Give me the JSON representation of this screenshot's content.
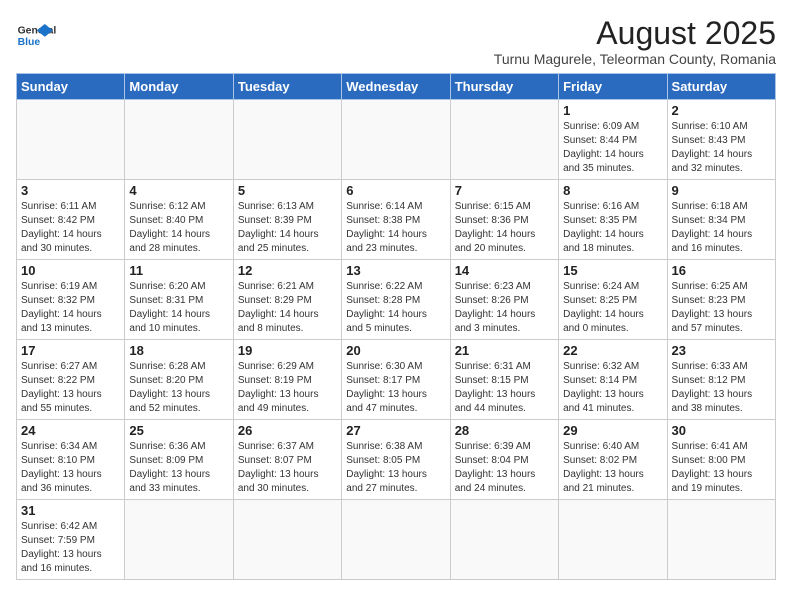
{
  "logo": {
    "text_general": "General",
    "text_blue": "Blue"
  },
  "title": "August 2025",
  "subtitle": "Turnu Magurele, Teleorman County, Romania",
  "weekdays": [
    "Sunday",
    "Monday",
    "Tuesday",
    "Wednesday",
    "Thursday",
    "Friday",
    "Saturday"
  ],
  "weeks": [
    [
      {
        "day": "",
        "info": ""
      },
      {
        "day": "",
        "info": ""
      },
      {
        "day": "",
        "info": ""
      },
      {
        "day": "",
        "info": ""
      },
      {
        "day": "",
        "info": ""
      },
      {
        "day": "1",
        "info": "Sunrise: 6:09 AM\nSunset: 8:44 PM\nDaylight: 14 hours and 35 minutes."
      },
      {
        "day": "2",
        "info": "Sunrise: 6:10 AM\nSunset: 8:43 PM\nDaylight: 14 hours and 32 minutes."
      }
    ],
    [
      {
        "day": "3",
        "info": "Sunrise: 6:11 AM\nSunset: 8:42 PM\nDaylight: 14 hours and 30 minutes."
      },
      {
        "day": "4",
        "info": "Sunrise: 6:12 AM\nSunset: 8:40 PM\nDaylight: 14 hours and 28 minutes."
      },
      {
        "day": "5",
        "info": "Sunrise: 6:13 AM\nSunset: 8:39 PM\nDaylight: 14 hours and 25 minutes."
      },
      {
        "day": "6",
        "info": "Sunrise: 6:14 AM\nSunset: 8:38 PM\nDaylight: 14 hours and 23 minutes."
      },
      {
        "day": "7",
        "info": "Sunrise: 6:15 AM\nSunset: 8:36 PM\nDaylight: 14 hours and 20 minutes."
      },
      {
        "day": "8",
        "info": "Sunrise: 6:16 AM\nSunset: 8:35 PM\nDaylight: 14 hours and 18 minutes."
      },
      {
        "day": "9",
        "info": "Sunrise: 6:18 AM\nSunset: 8:34 PM\nDaylight: 14 hours and 16 minutes."
      }
    ],
    [
      {
        "day": "10",
        "info": "Sunrise: 6:19 AM\nSunset: 8:32 PM\nDaylight: 14 hours and 13 minutes."
      },
      {
        "day": "11",
        "info": "Sunrise: 6:20 AM\nSunset: 8:31 PM\nDaylight: 14 hours and 10 minutes."
      },
      {
        "day": "12",
        "info": "Sunrise: 6:21 AM\nSunset: 8:29 PM\nDaylight: 14 hours and 8 minutes."
      },
      {
        "day": "13",
        "info": "Sunrise: 6:22 AM\nSunset: 8:28 PM\nDaylight: 14 hours and 5 minutes."
      },
      {
        "day": "14",
        "info": "Sunrise: 6:23 AM\nSunset: 8:26 PM\nDaylight: 14 hours and 3 minutes."
      },
      {
        "day": "15",
        "info": "Sunrise: 6:24 AM\nSunset: 8:25 PM\nDaylight: 14 hours and 0 minutes."
      },
      {
        "day": "16",
        "info": "Sunrise: 6:25 AM\nSunset: 8:23 PM\nDaylight: 13 hours and 57 minutes."
      }
    ],
    [
      {
        "day": "17",
        "info": "Sunrise: 6:27 AM\nSunset: 8:22 PM\nDaylight: 13 hours and 55 minutes."
      },
      {
        "day": "18",
        "info": "Sunrise: 6:28 AM\nSunset: 8:20 PM\nDaylight: 13 hours and 52 minutes."
      },
      {
        "day": "19",
        "info": "Sunrise: 6:29 AM\nSunset: 8:19 PM\nDaylight: 13 hours and 49 minutes."
      },
      {
        "day": "20",
        "info": "Sunrise: 6:30 AM\nSunset: 8:17 PM\nDaylight: 13 hours and 47 minutes."
      },
      {
        "day": "21",
        "info": "Sunrise: 6:31 AM\nSunset: 8:15 PM\nDaylight: 13 hours and 44 minutes."
      },
      {
        "day": "22",
        "info": "Sunrise: 6:32 AM\nSunset: 8:14 PM\nDaylight: 13 hours and 41 minutes."
      },
      {
        "day": "23",
        "info": "Sunrise: 6:33 AM\nSunset: 8:12 PM\nDaylight: 13 hours and 38 minutes."
      }
    ],
    [
      {
        "day": "24",
        "info": "Sunrise: 6:34 AM\nSunset: 8:10 PM\nDaylight: 13 hours and 36 minutes."
      },
      {
        "day": "25",
        "info": "Sunrise: 6:36 AM\nSunset: 8:09 PM\nDaylight: 13 hours and 33 minutes."
      },
      {
        "day": "26",
        "info": "Sunrise: 6:37 AM\nSunset: 8:07 PM\nDaylight: 13 hours and 30 minutes."
      },
      {
        "day": "27",
        "info": "Sunrise: 6:38 AM\nSunset: 8:05 PM\nDaylight: 13 hours and 27 minutes."
      },
      {
        "day": "28",
        "info": "Sunrise: 6:39 AM\nSunset: 8:04 PM\nDaylight: 13 hours and 24 minutes."
      },
      {
        "day": "29",
        "info": "Sunrise: 6:40 AM\nSunset: 8:02 PM\nDaylight: 13 hours and 21 minutes."
      },
      {
        "day": "30",
        "info": "Sunrise: 6:41 AM\nSunset: 8:00 PM\nDaylight: 13 hours and 19 minutes."
      }
    ],
    [
      {
        "day": "31",
        "info": "Sunrise: 6:42 AM\nSunset: 7:59 PM\nDaylight: 13 hours and 16 minutes."
      },
      {
        "day": "",
        "info": ""
      },
      {
        "day": "",
        "info": ""
      },
      {
        "day": "",
        "info": ""
      },
      {
        "day": "",
        "info": ""
      },
      {
        "day": "",
        "info": ""
      },
      {
        "day": "",
        "info": ""
      }
    ]
  ]
}
